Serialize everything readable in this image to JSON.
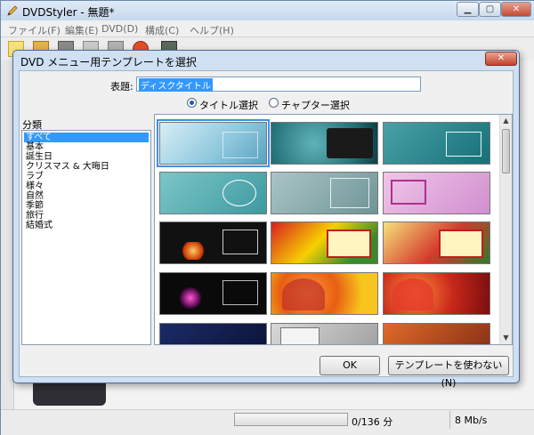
{
  "app": {
    "title": "DVDStyler - 無題*",
    "menu": [
      "ファイル(F)",
      "編集(E)",
      "DVD(D)",
      "構成(C)",
      "ヘルプ(H)"
    ]
  },
  "status": {
    "progress_text": "0/136 分",
    "bitrate": "8 Mb/s"
  },
  "dialog": {
    "title": "DVD メニュー用テンプレートを選択",
    "title_label": "表題:",
    "title_value": "ディスクタイトル",
    "radio_title": "タイトル選択",
    "radio_chapter": "チャプター選択",
    "category_label": "分類",
    "categories": [
      "すべて",
      "基本",
      "誕生日",
      "クリスマス & 大晦日",
      "ラブ",
      "様々",
      "自然",
      "季節",
      "旅行",
      "結婚式"
    ],
    "ok_label": "OK",
    "no_template_label": "テンプレートを使わない(N)"
  },
  "colors": {
    "accent": "#3399ff",
    "dialog_frame": "#cfe0f3"
  },
  "icons": [
    "pencil-icon",
    "minimize-icon",
    "maximize-icon",
    "close-icon"
  ]
}
